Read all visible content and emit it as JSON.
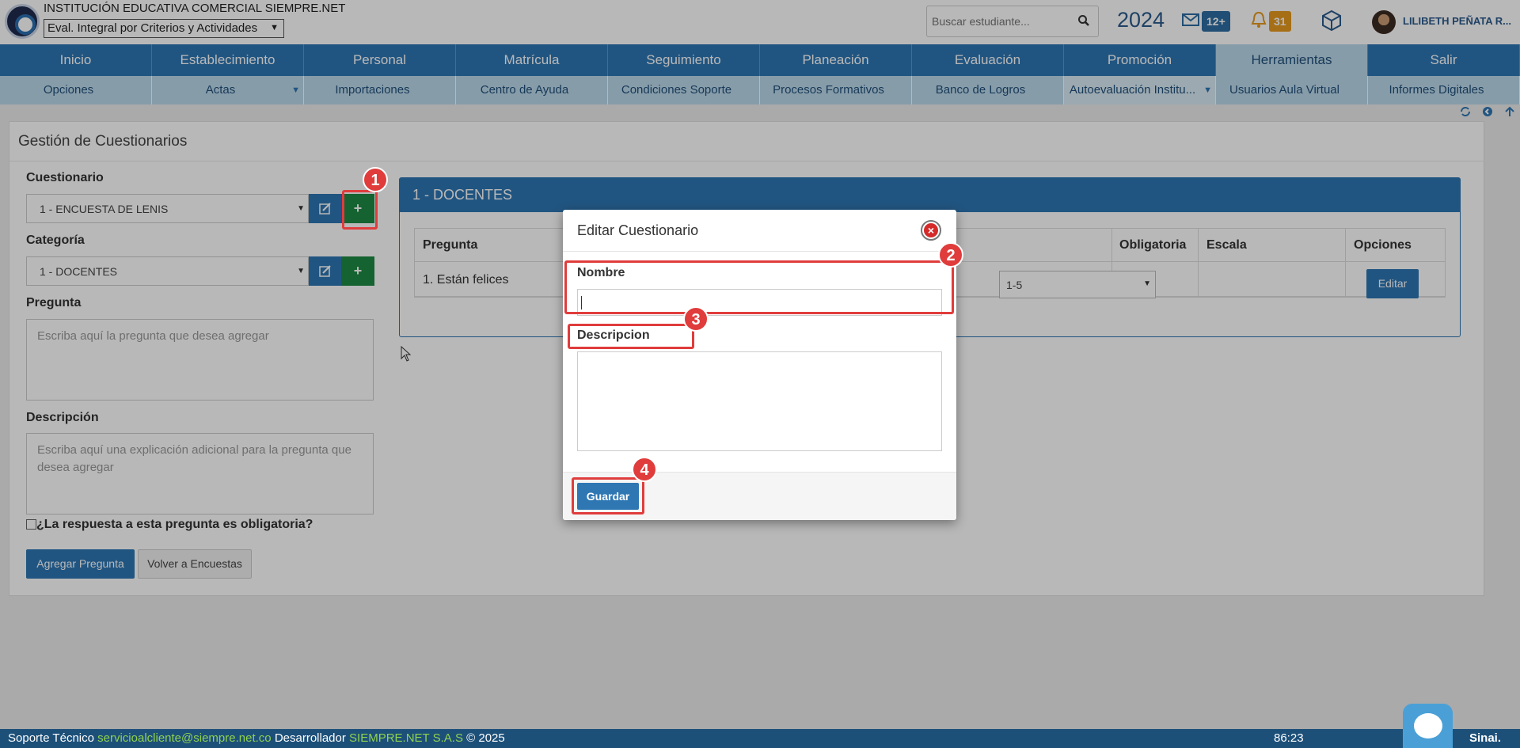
{
  "header": {
    "institution": "INSTITUCIÓN EDUCATIVA COMERCIAL SIEMPRE.NET",
    "eval_select": "Eval. Integral por Criterios y Actividades",
    "search_placeholder": "Buscar estudiante...",
    "year": "2024",
    "messages_badge": "12+",
    "notifications_badge": "31",
    "user_name": "LILIBETH PEÑATA R..."
  },
  "main_nav": [
    "Inicio",
    "Establecimiento",
    "Personal",
    "Matrícula",
    "Seguimiento",
    "Planeación",
    "Evaluación",
    "Promoción",
    "Herramientas",
    "Salir"
  ],
  "sub_nav": [
    "Opciones",
    "Actas",
    "Importaciones",
    "Centro de Ayuda",
    "Condiciones Soporte",
    "Procesos Formativos",
    "Banco de Logros",
    "Autoevaluación Institu...",
    "Usuarios Aula Virtual",
    "Informes Digitales"
  ],
  "panel": {
    "title": "Gestión de Cuestionarios",
    "cuestionario_label": "Cuestionario",
    "cuestionario_value": "1 - ENCUESTA DE LENIS",
    "categoria_label": "Categoría",
    "categoria_value": "1 - DOCENTES",
    "pregunta_label": "Pregunta",
    "pregunta_placeholder": "Escriba aquí la pregunta que desea agregar",
    "descripcion_label": "Descripción",
    "descripcion_placeholder": "Escriba aquí una explicación adicional para la pregunta que desea agregar",
    "obligatoria_label": "¿La respuesta a esta pregunta es obligatoria?",
    "agregar_button": "Agregar Pregunta",
    "volver_button": "Volver a Encuestas"
  },
  "category_box": {
    "title": "1 - DOCENTES",
    "columns": [
      "Pregunta",
      "Obligatoria",
      "Escala",
      "Opciones"
    ],
    "rows": [
      {
        "pregunta": "1. Están felices",
        "escala": "1-5",
        "action": "Editar"
      }
    ]
  },
  "modal": {
    "title": "Editar Cuestionario",
    "close": "×",
    "nombre_label": "Nombre",
    "nombre_value": "",
    "descripcion_label": "Descripcion",
    "descripcion_value": "",
    "save_button": "Guardar"
  },
  "annotations": [
    "1",
    "2",
    "3",
    "4"
  ],
  "footer": {
    "support": "Soporte Técnico",
    "email": "servicioalcliente@siempre.net.co",
    "developer": "Desarrollador",
    "company": "SIEMPRE.NET S.A.S",
    "year": "2025",
    "timer": "86:23",
    "brand": "Sinai."
  },
  "colors": {
    "primary": "#2e77b3",
    "success": "#1e8a43",
    "annotation": "#e03c3c",
    "warning_badge": "#e79a1f"
  }
}
